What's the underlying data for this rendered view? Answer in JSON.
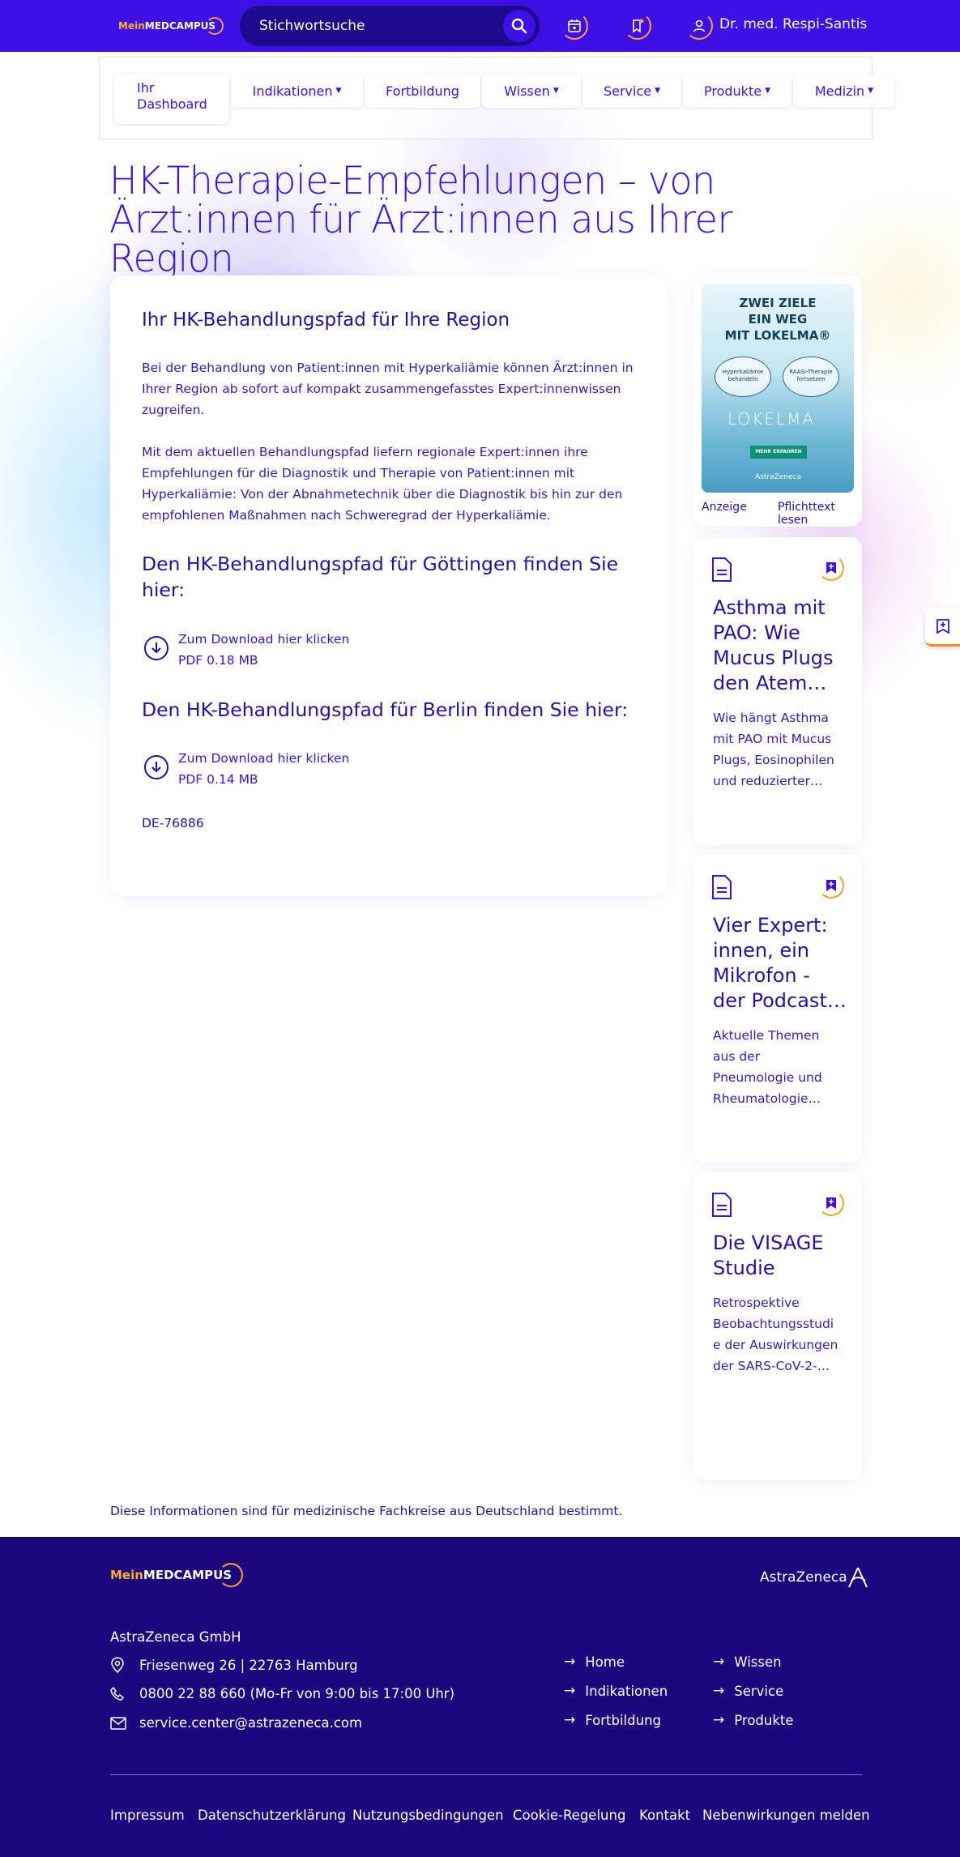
{
  "header": {
    "logo_mein": "Mein",
    "logo_medcampus": "MEDCAMPUS",
    "search_placeholder": "Stichwortsuche",
    "user_name": "Dr. med. Respi-Santis"
  },
  "nav": {
    "dashboard_line1": "Ihr",
    "dashboard_line2": "Dashboard",
    "items": [
      {
        "label": "Indikationen",
        "dropdown": true
      },
      {
        "label": "Fortbildung",
        "dropdown": false
      },
      {
        "label": "Wissen",
        "dropdown": true
      },
      {
        "label": "Service",
        "dropdown": true
      },
      {
        "label": "Produkte",
        "dropdown": true
      },
      {
        "label": "Medizin",
        "dropdown": true
      }
    ]
  },
  "page": {
    "title_line1": "HK-Therapie-Empfehlungen – von",
    "title_line2": "Ärzt:innen für Ärzt:innen aus Ihrer Region"
  },
  "main": {
    "heading": "Ihr HK-Behandlungspfad für Ihre Region",
    "para1_l1": "Bei der Behandlung von Patient:innen mit Hyperkaliämie können Ärzt:innen in",
    "para1_l2": "Ihrer Region ab sofort auf kompakt zusammengefasstes Expert:innenwissen",
    "para1_l3": "zugreifen.",
    "para2_l1": "Mit dem aktuellen Behandlungspfad liefern regionale Expert:innen ihre",
    "para2_l2": "Empfehlungen für die Diagnostik und Therapie von Patient:innen mit",
    "para2_l3": "Hyperkaliämie: Von der Abnahmetechnik über die Diagnostik bis hin zur den",
    "para2_l4": "empfohlenen Maßnahmen nach Schweregrad der Hyperkaliämie.",
    "goettingen_heading_l1": "Den HK-Behandlungspfad für Göttingen finden Sie",
    "goettingen_heading_l2": "hier:",
    "goettingen_link": "Zum Download hier klicken",
    "goettingen_size": "PDF 0.18 MB",
    "berlin_heading": "Den HK-Behandlungspfad für Berlin finden Sie hier:",
    "berlin_link": "Zum Download hier klicken",
    "berlin_size": "PDF 0.14 MB",
    "code": "DE-76886"
  },
  "ad": {
    "headline_l1": "ZWEI ZIELE",
    "headline_l2": "EIN WEG",
    "headline_l3": "MIT LOKELMA®",
    "bubble_left": "Hyperkaliämie behandeln",
    "bubble_right": "RAASi-Therapie fortsetzen",
    "brand": "LOKELMA",
    "cta": "MEHR ERFAHREN",
    "maker": "AstraZeneca",
    "label_left": "Anzeige",
    "label_right": "Pflichttext lesen"
  },
  "side_cards": [
    {
      "title_l1": "Asthma mit",
      "title_l2": "PAO: Wie",
      "title_l3": "Mucus Plugs",
      "title_l4": "den Atem…",
      "desc_l1": "Wie hängt Asthma",
      "desc_l2": "mit PAO mit Mucus",
      "desc_l3": "Plugs, Eosinophilen",
      "desc_l4": "und reduzierter…"
    },
    {
      "title_l1": "Vier Expert:",
      "title_l2": "innen, ein",
      "title_l3": "Mikrofon -",
      "title_l4": "der Podcast…",
      "desc_l1": "Aktuelle Themen",
      "desc_l2": "aus der",
      "desc_l3": "Pneumologie und",
      "desc_l4": "Rheumatologie…"
    },
    {
      "title_l1": "Die VISAGE",
      "title_l2": "Studie",
      "desc_l1": "Retrospektive",
      "desc_l2": "Beobachtungsstudi",
      "desc_l3": "e der Auswirkungen",
      "desc_l4": "der SARS-CoV-2-…"
    }
  ],
  "disclaimer": "Diese Informationen sind für medizinische Fachkreise aus Deutschland bestimmt.",
  "footer": {
    "logo_mein": "Mein",
    "logo_medcampus": "MEDCAMPUS",
    "brand": "AstraZeneca",
    "company": "AstraZeneca GmbH",
    "address": "Friesenweg 26 | 22763 Hamburg",
    "phone": "0800 22 88 660 (Mo-Fr von 9:00 bis 17:00 Uhr)",
    "email": "service.center@astrazeneca.com",
    "links_col1": [
      "Home",
      "Indikationen",
      "Fortbildung"
    ],
    "links_col2": [
      "Wissen",
      "Service",
      "Produkte"
    ],
    "bottom_links": [
      "Impressum",
      "Datenschutzerklärung",
      "Nutzungsbedingungen",
      "Cookie-Regelung",
      "Kontakt",
      "Nebenwirkungen melden"
    ]
  },
  "colors": {
    "primary": "#3c10e6",
    "navy": "#1e0580",
    "accent": "#ff9d2e"
  }
}
